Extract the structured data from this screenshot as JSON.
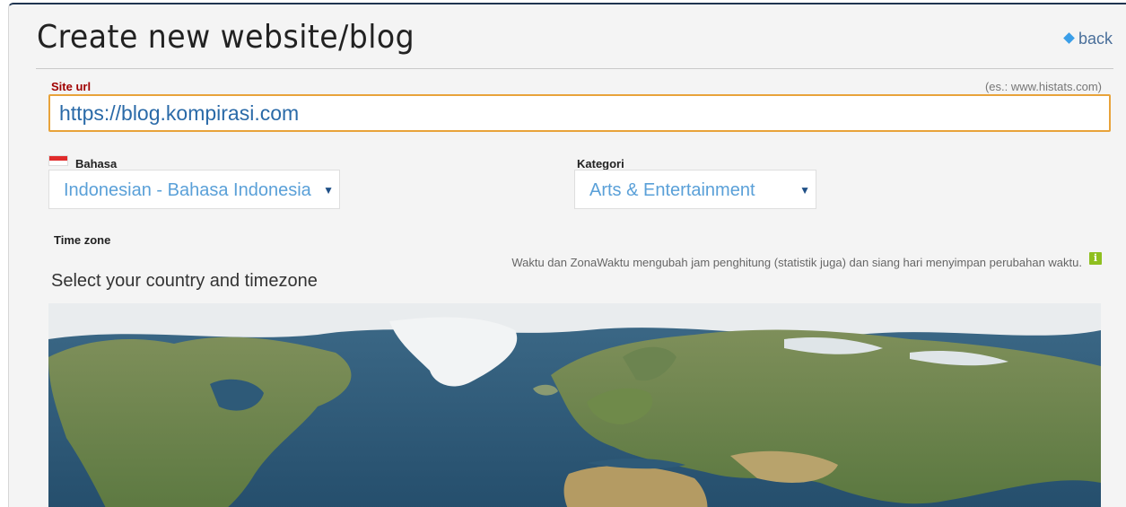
{
  "header": {
    "title": "Create new website/blog",
    "back_label": "back"
  },
  "site_url": {
    "label": "Site url",
    "hint": "(es.: www.histats.com)",
    "value": "https://blog.kompirasi.com"
  },
  "language": {
    "label": "Bahasa",
    "selected": "Indonesian - Bahasa Indonesia"
  },
  "category": {
    "label": "Kategori",
    "selected": "Arts & Entertainment"
  },
  "timezone": {
    "label": "Time zone",
    "info": "Waktu dan ZonaWaktu mengubah jam penghitung (statistik juga) dan siang hari menyimpan perubahan waktu.",
    "select_prompt": "Select your country and timezone"
  },
  "colors": {
    "accent_border": "#e8a33a",
    "url_label": "#a00000",
    "link": "#4a6f9a",
    "info_icon": "#8fbf1f",
    "ocean": "#2d5775"
  },
  "icons": {
    "back": "diamond-icon",
    "flag": "indonesia-flag-icon",
    "info": "info-icon",
    "caret": "caret-down-icon"
  }
}
